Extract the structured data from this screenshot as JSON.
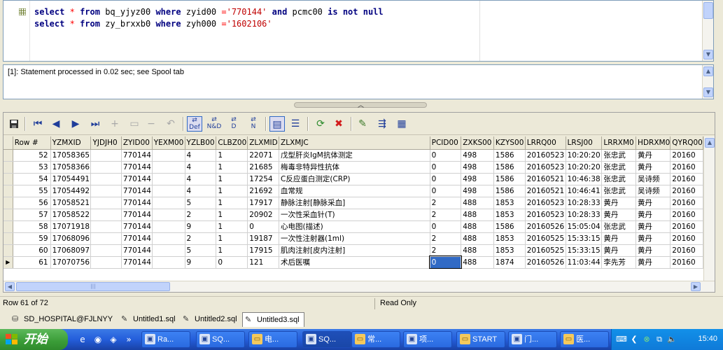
{
  "editor": {
    "lines": [
      {
        "tokens": [
          {
            "t": "select",
            "c": "kw"
          },
          {
            "t": " ",
            "c": ""
          },
          {
            "t": "*",
            "c": "op"
          },
          {
            "t": " ",
            "c": ""
          },
          {
            "t": "from",
            "c": "kw"
          },
          {
            "t": " bq_yjyz00 ",
            "c": ""
          },
          {
            "t": "where",
            "c": "kw"
          },
          {
            "t": " zyid00 ",
            "c": ""
          },
          {
            "t": "=",
            "c": "op"
          },
          {
            "t": "'770144'",
            "c": "str"
          },
          {
            "t": " ",
            "c": ""
          },
          {
            "t": "and",
            "c": "kw"
          },
          {
            "t": " pcmc00 ",
            "c": ""
          },
          {
            "t": "is",
            "c": "kw"
          },
          {
            "t": " ",
            "c": ""
          },
          {
            "t": "not",
            "c": "kw"
          },
          {
            "t": " ",
            "c": ""
          },
          {
            "t": "null",
            "c": "kw"
          }
        ]
      },
      {
        "tokens": [
          {
            "t": "select",
            "c": "kw"
          },
          {
            "t": " ",
            "c": ""
          },
          {
            "t": "*",
            "c": "op"
          },
          {
            "t": " ",
            "c": ""
          },
          {
            "t": "from",
            "c": "kw"
          },
          {
            "t": " zy_brxxb0 ",
            "c": ""
          },
          {
            "t": "where",
            "c": "kw"
          },
          {
            "t": " zyh000 ",
            "c": ""
          },
          {
            "t": "=",
            "c": "op"
          },
          {
            "t": "'1602106'",
            "c": "str"
          }
        ]
      }
    ]
  },
  "message": "[1]: Statement processed in 0.02 sec; see Spool tab",
  "grid": {
    "columns": [
      "Row #",
      "YZMXID",
      "YJDJH0",
      "ZYID00",
      "YEXM00",
      "YZLB00",
      "CLBZ00",
      "ZLXMID",
      "ZLXMJC",
      "PCID00",
      "ZXKS00",
      "KZYS00",
      "LRRQ00",
      "LRSJ00",
      "LRRXM0",
      "HDRXM0",
      "QYRQ00"
    ],
    "rows": [
      [
        "52",
        "17058365",
        "",
        "770144",
        "",
        "4",
        "1",
        "22071",
        "戊型肝炎IgM抗体测定",
        "0",
        "498",
        "1586",
        "20160523",
        "10:20:20",
        "张忠武",
        "黄丹",
        "20160"
      ],
      [
        "53",
        "17058366",
        "",
        "770144",
        "",
        "4",
        "1",
        "21685",
        "梅毒非特异性抗体",
        "0",
        "498",
        "1586",
        "20160523",
        "10:20:20",
        "张忠武",
        "黄丹",
        "20160"
      ],
      [
        "54",
        "17054491",
        "",
        "770144",
        "",
        "4",
        "1",
        "17254",
        "C反应蛋白测定(CRP)",
        "0",
        "498",
        "1586",
        "20160521",
        "10:46:38",
        "张忠武",
        "吴诗频",
        "20160"
      ],
      [
        "55",
        "17054492",
        "",
        "770144",
        "",
        "4",
        "1",
        "21692",
        "血常规",
        "0",
        "498",
        "1586",
        "20160521",
        "10:46:41",
        "张忠武",
        "吴诗频",
        "20160"
      ],
      [
        "56",
        "17058521",
        "",
        "770144",
        "",
        "5",
        "1",
        "17917",
        "静脉注射[静脉采血]",
        "2",
        "488",
        "1853",
        "20160523",
        "10:28:33",
        "黄丹",
        "黄丹",
        "20160"
      ],
      [
        "57",
        "17058522",
        "",
        "770144",
        "",
        "2",
        "1",
        "20902",
        "一次性采血针(T)",
        "2",
        "488",
        "1853",
        "20160523",
        "10:28:33",
        "黄丹",
        "黄丹",
        "20160"
      ],
      [
        "58",
        "17071918",
        "",
        "770144",
        "",
        "9",
        "1",
        "0",
        "心电图(描述)",
        "0",
        "488",
        "1586",
        "20160526",
        "15:05:04",
        "张忠武",
        "黄丹",
        "20160"
      ],
      [
        "59",
        "17068096",
        "",
        "770144",
        "",
        "2",
        "1",
        "19187",
        "一次性注射器(1ml)",
        "2",
        "488",
        "1853",
        "20160525",
        "15:33:15",
        "黄丹",
        "黄丹",
        "20160"
      ],
      [
        "60",
        "17068097",
        "",
        "770144",
        "",
        "5",
        "1",
        "17915",
        "肌肉注射[皮内注射]",
        "2",
        "488",
        "1853",
        "20160525",
        "15:33:15",
        "黄丹",
        "黄丹",
        "20160"
      ],
      [
        "61",
        "17070756",
        "",
        "770144",
        "",
        "9",
        "0",
        "121",
        "术后医嘱",
        "0",
        "488",
        "1874",
        "20160526",
        "11:03:44",
        "李先芳",
        "黄丹",
        "20160"
      ]
    ],
    "current_row_index": 9,
    "selected_col_index": 9
  },
  "status": {
    "row_info": "Row 61 of 72",
    "mode": "Read Only"
  },
  "doc_tabs": [
    {
      "label": "SD_HOSPITAL@FJLNYY",
      "icon": "database-icon",
      "active": false
    },
    {
      "label": "Untitled1.sql",
      "icon": "sql-file-icon",
      "active": false
    },
    {
      "label": "Untitled2.sql",
      "icon": "sql-file-icon",
      "active": false
    },
    {
      "label": "Untitled3.sql",
      "icon": "sql-file-icon",
      "active": true
    }
  ],
  "taskbar": {
    "start_label": "开始",
    "tasks": [
      {
        "label": "Ra...",
        "icon": "app-icon"
      },
      {
        "label": "SQ...",
        "icon": "app-icon"
      },
      {
        "label": "电...",
        "icon": "folder-icon"
      },
      {
        "label": "SQ...",
        "icon": "app-icon",
        "active": true
      },
      {
        "label": "常...",
        "icon": "folder-icon"
      },
      {
        "label": "项...",
        "icon": "app-icon"
      },
      {
        "label": "START",
        "icon": "folder-icon"
      },
      {
        "label": "门...",
        "icon": "app-icon"
      },
      {
        "label": "医...",
        "icon": "folder-icon"
      }
    ],
    "clock": "15:40"
  }
}
